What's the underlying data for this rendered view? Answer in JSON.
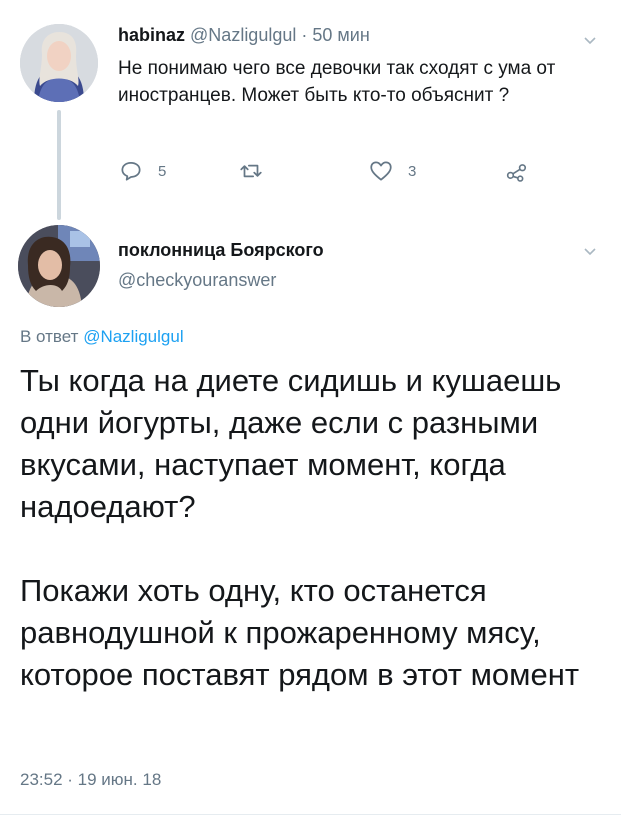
{
  "first_tweet": {
    "name": "habinaz",
    "handle": "@Nazligulgul",
    "separator": "·",
    "time": "50 мин",
    "text": "Не понимаю чего все девочки так сходят с ума от иностранцев. Может быть кто-то объяснит ?",
    "actions": {
      "reply_count": "5",
      "retweet_count": "",
      "like_count": "3"
    }
  },
  "second_tweet": {
    "name": "поклонница Боярского",
    "handle": "@checkyouranswer",
    "reply_prefix": "В ответ",
    "reply_mention": "@Nazligulgul",
    "paragraph_1": "Ты когда на диете сидишь и кушаешь одни йогурты, даже если с разными вкусами, наступает момент, когда надоедают?",
    "paragraph_2": "Покажи хоть одну, кто останется равнодушной к прожаренному мясу, которое поставят рядом в этот момент",
    "timestamp": "23:52 · 19 июн. 18"
  },
  "colors": {
    "text": "#14171a",
    "secondary": "#657786",
    "link": "#1da1f2",
    "thread_line": "#ccd6dd"
  },
  "icons": [
    "chevron-down-icon",
    "reply-icon",
    "retweet-icon",
    "like-icon",
    "share-icon"
  ]
}
